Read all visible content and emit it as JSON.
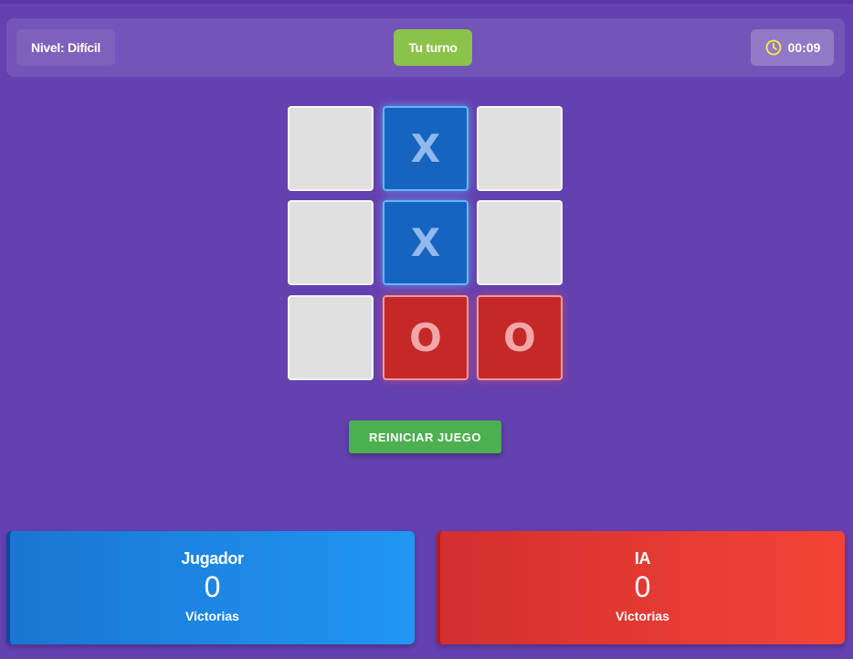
{
  "header": {
    "level": "Nivel: Difícil",
    "turn": "Tu turno",
    "timer": "00:09",
    "timer_icon": "clock-icon",
    "timer_icon_color": "#ffeb3b"
  },
  "board": {
    "cells": [
      "",
      "X",
      "",
      "",
      "X",
      "",
      "",
      "O",
      "O"
    ],
    "x_color": "#1565c0",
    "o_color": "#c62828"
  },
  "controls": {
    "reset_label": "REINICIAR JUEGO"
  },
  "scores": {
    "player": {
      "name": "Jugador",
      "value": "0",
      "caption": "Victorias"
    },
    "ai": {
      "name": "IA",
      "value": "0",
      "caption": "Victorias"
    }
  }
}
